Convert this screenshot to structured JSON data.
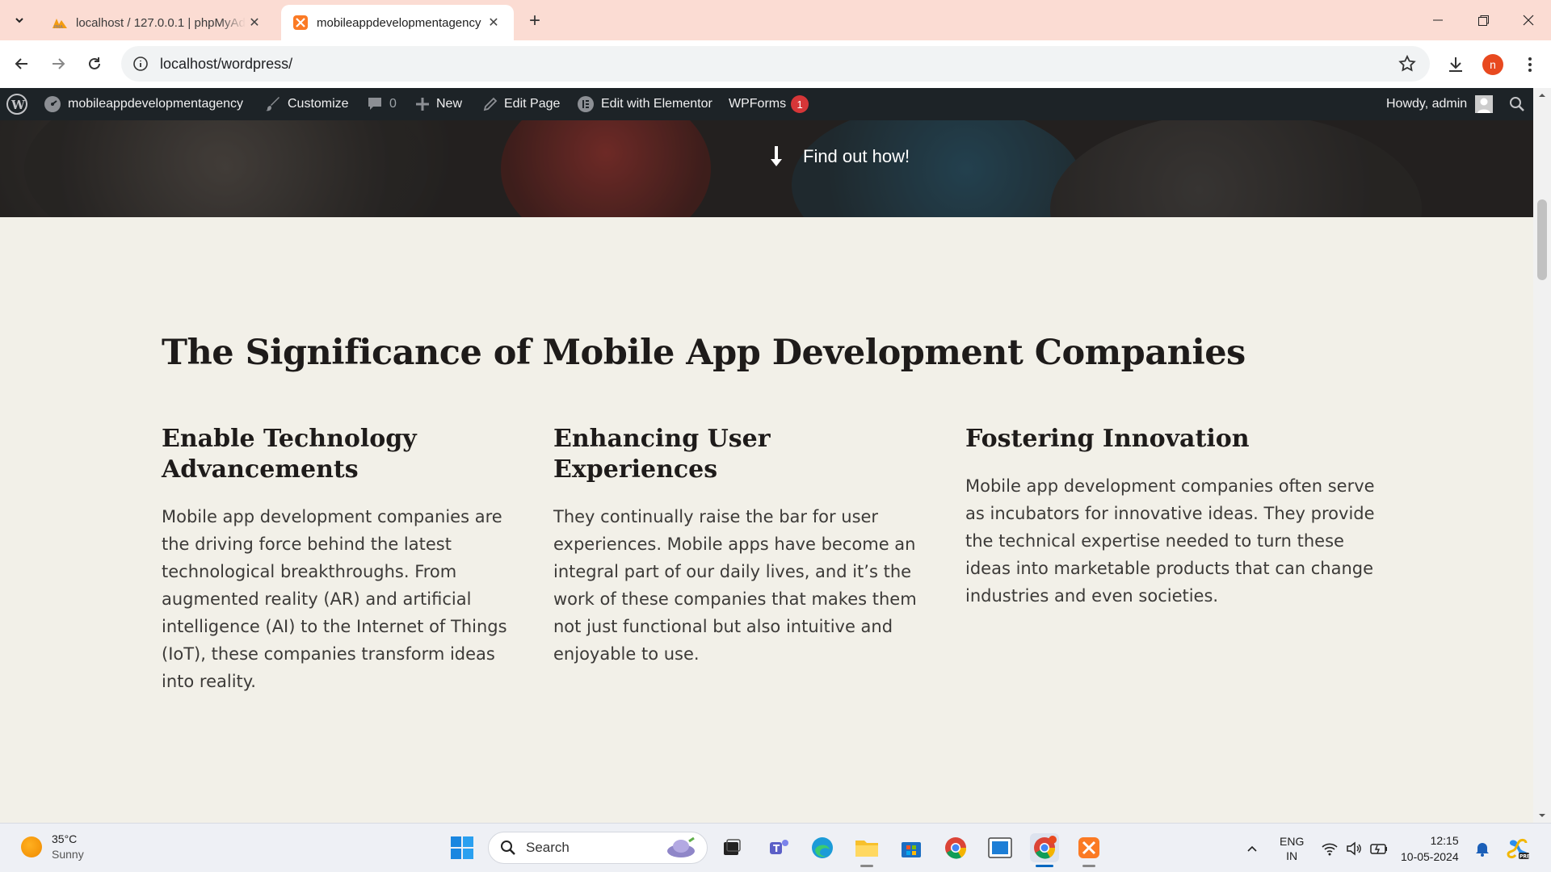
{
  "browser": {
    "tabs": [
      {
        "title": "localhost / 127.0.0.1 | phpMyAdmin",
        "active": false
      },
      {
        "title": "mobileappdevelopmentagency",
        "active": true
      }
    ],
    "url": "localhost/wordpress/",
    "profile_initial": "n"
  },
  "adminbar": {
    "site_name": "mobileappdevelopmentagency",
    "customize": "Customize",
    "comments_count": "0",
    "new": "New",
    "edit_page": "Edit Page",
    "edit_elementor": "Edit with Elementor",
    "wpforms": "WPForms",
    "wpforms_badge": "1",
    "howdy": "Howdy, admin"
  },
  "hero": {
    "cta": "Find out how!"
  },
  "section": {
    "heading": "The Significance of Mobile App Development Companies",
    "columns": [
      {
        "title": "Enable Technology Advancements",
        "text": "Mobile app development companies are the driving force behind the latest technological breakthroughs. From augmented reality (AR) and artificial intelligence (AI) to the Internet of Things (IoT), these companies transform ideas into reality."
      },
      {
        "title": "Enhancing User Experiences",
        "text": "They continually raise the bar for user experiences. Mobile apps have become an integral part of our daily lives, and it’s the work of these companies that makes them not just functional but also intuitive and enjoyable to use."
      },
      {
        "title": "Fostering Innovation",
        "text": "Mobile app development companies often serve as incubators for innovative ideas. They provide the technical expertise needed to turn these ideas into marketable products that can change industries and even societies."
      }
    ]
  },
  "taskbar": {
    "weather_temp": "35°C",
    "weather_desc": "Sunny",
    "search_label": "Search",
    "lang_line1": "ENG",
    "lang_line2": "IN",
    "time": "12:15",
    "date": "10-05-2024"
  },
  "colors": {
    "accent_orange": "#e8491f",
    "admin_bar": "#1d2327",
    "page_bg": "#f2f0e8",
    "badge_red": "#d63638"
  }
}
